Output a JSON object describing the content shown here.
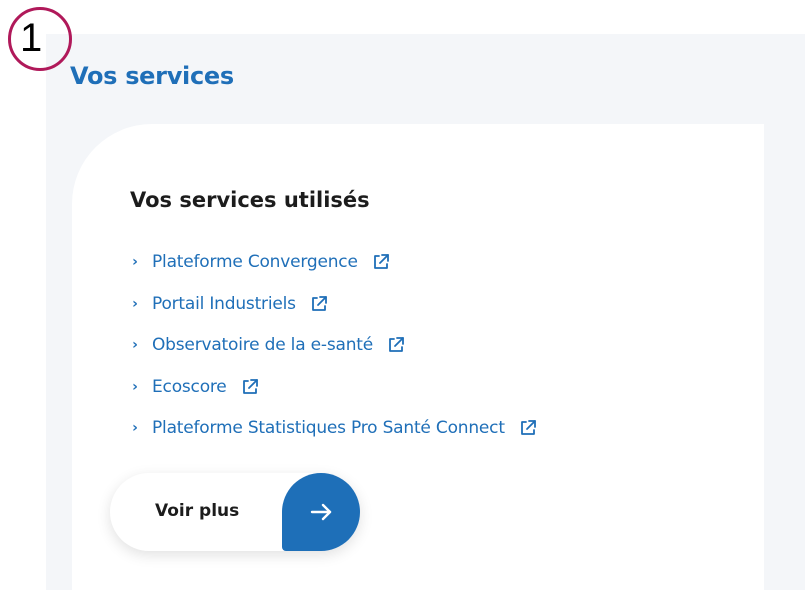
{
  "step_marker": {
    "number": "1"
  },
  "section": {
    "title": "Vos services"
  },
  "card": {
    "title": "Vos services utilisés",
    "services": [
      {
        "label": "Plateforme Convergence",
        "icon": "external-link-icon"
      },
      {
        "label": "Portail Industriels",
        "icon": "external-link-icon"
      },
      {
        "label": "Observatoire de la e-santé",
        "icon": "external-link-icon"
      },
      {
        "label": "Ecoscore",
        "icon": "external-link-icon"
      },
      {
        "label": "Plateforme Statistiques Pro Santé Connect",
        "icon": "external-link-icon"
      }
    ],
    "more_button": {
      "label": "Voir plus",
      "icon": "arrow-right-icon"
    }
  },
  "colors": {
    "accent": "#1f6fb8",
    "marker": "#b0195a",
    "panel_background": "#f4f6f9"
  }
}
